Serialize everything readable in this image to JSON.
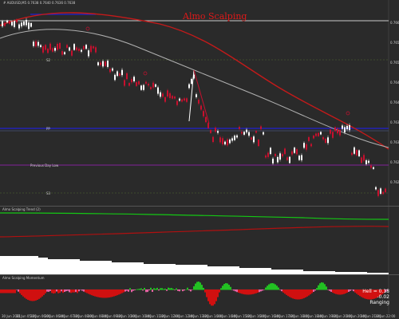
{
  "header": {
    "title": "Almo Scalping",
    "symbol_text": "# AUDUSD,M5 0.7638 0.7640 0.7636 0.7638"
  },
  "main_chart": {
    "level_labels": {
      "l1": "S2",
      "l2": "S1",
      "l3": "PP",
      "l4": "Previous Day Low",
      "l5": "S3"
    },
    "price_ticks": [
      "0.7660",
      "0.7655",
      "0.7650",
      "0.7645",
      "0.7640",
      "0.7635",
      "0.7630",
      "0.7625",
      "0.7620"
    ],
    "colors": {
      "background": "#2a2a2a",
      "candle_up": "#ffffff",
      "candle_down": "#c8102e",
      "ma_slow": "#c41a1a",
      "ma_mid": "#b0b0b0",
      "blue_line": "#2020d0",
      "purple_line": "#a020c0",
      "olive_line": "#556b2f"
    }
  },
  "sub_panel1": {
    "label": "Almo Scalping Trend (2)",
    "colors": {
      "green_line": "#14c814",
      "red_line": "#b01010",
      "fill": "#ffffff"
    }
  },
  "sub_panel2": {
    "label": "Almo Scalping Momentum",
    "values": {
      "line1": "Hell = 0.18",
      "line2": "-0.02",
      "line3": "Ranging"
    },
    "colors": {
      "positive": "#22c022",
      "negative": "#d01010",
      "pink": "#e060a0"
    }
  },
  "time_axis": {
    "labels": [
      "30 Jun 2021",
      "30 Jun 05:20",
      "30 Jun 06:00",
      "30 Jun 06:40",
      "30 Jun 07:20",
      "30 Jun 08:00",
      "30 Jun 08:40",
      "30 Jun 09:20",
      "30 Jun 10:00",
      "30 Jun 10:40",
      "30 Jun 11:20",
      "30 Jun 12:00",
      "30 Jun 12:40",
      "30 Jun 13:20",
      "30 Jun 14:00",
      "30 Jun 14:40",
      "30 Jun 15:20",
      "30 Jun 16:00",
      "30 Jun 16:40",
      "30 Jun 17:20",
      "30 Jun 18:00",
      "30 Jun 18:40",
      "30 Jun 19:20",
      "30 Jun 20:00",
      "30 Jun 20:40",
      "30 Jun 21:20",
      "30 Jun 22:00"
    ]
  }
}
